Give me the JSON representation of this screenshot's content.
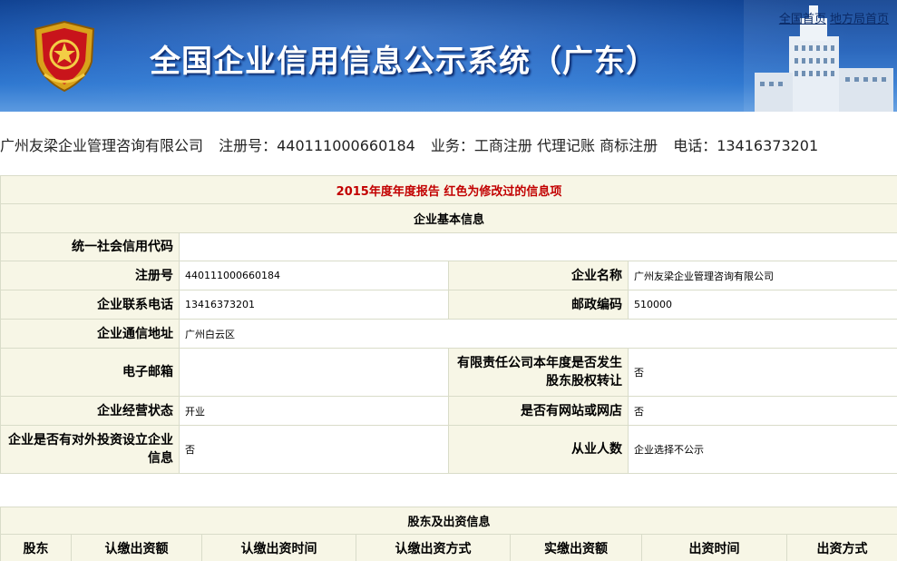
{
  "header": {
    "title": "全国企业信用信息公示系统（广东）",
    "links": {
      "national": "全国首页",
      "local": "地方局首页"
    }
  },
  "company_bar": {
    "name": "广州友梁企业管理咨询有限公司",
    "reg_no": "注册号：440111000660184",
    "business": "业务：工商注册 代理记账 商标注册",
    "phone": "电话：13416373201"
  },
  "report": {
    "title": "2015年度年度报告  红色为修改过的信息项",
    "section_basic": "企业基本信息",
    "rows": {
      "credit_code_label": "统一社会信用代码",
      "credit_code_value": "",
      "reg_no_label": "注册号",
      "reg_no_value": "440111000660184",
      "company_name_label": "企业名称",
      "company_name_value": "广州友梁企业管理咨询有限公司",
      "phone_label": "企业联系电话",
      "phone_value": "13416373201",
      "postcode_label": "邮政编码",
      "postcode_value": "510000",
      "address_label": "企业通信地址",
      "address_value": "广州白云区",
      "email_label": "电子邮箱",
      "email_value": "",
      "equity_transfer_label": "有限责任公司本年度是否发生股东股权转让",
      "equity_transfer_value": "否",
      "status_label": "企业经营状态",
      "status_value": "开业",
      "website_label": "是否有网站或网店",
      "website_value": "否",
      "investment_label": "企业是否有对外投资设立企业信息",
      "investment_value": "否",
      "employees_label": "从业人数",
      "employees_value": "企业选择不公示"
    }
  },
  "shareholders": {
    "title": "股东及出资信息",
    "columns": [
      "股东",
      "认缴出资额",
      "认缴出资时间",
      "认缴出资方式",
      "实缴出资额",
      "出资时间",
      "出资方式"
    ]
  },
  "colors": {
    "header_blue": "#1b5cb8",
    "label_bg": "#f7f6e6",
    "highlight_red": "#c20000"
  }
}
